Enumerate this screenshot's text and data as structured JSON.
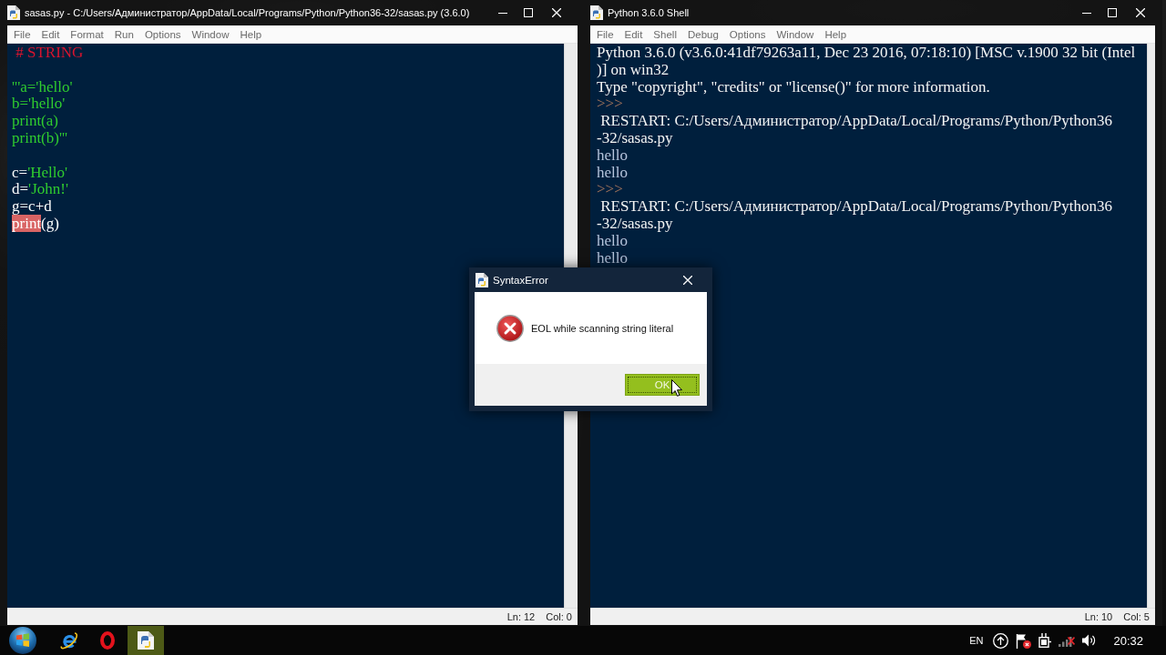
{
  "editor_window": {
    "title": "sasas.py - C:/Users/Администратор/AppData/Local/Programs/Python/Python36-32/sasas.py (3.6.0)",
    "menu": [
      "File",
      "Edit",
      "Format",
      "Run",
      "Options",
      "Window",
      "Help"
    ],
    "blocks": [
      {
        "lines": [
          {
            "segments": [
              {
                "kind": "comment",
                "text": " # STRING"
              }
            ]
          }
        ]
      },
      {
        "lines": [
          {
            "segments": [
              {
                "kind": "string",
                "text": "'''a='hello'"
              }
            ]
          },
          {
            "segments": [
              {
                "kind": "string",
                "text": "b='hello'"
              }
            ]
          },
          {
            "segments": [
              {
                "kind": "string",
                "text": "print(a)"
              }
            ]
          },
          {
            "segments": [
              {
                "kind": "string",
                "text": "print(b)'''"
              }
            ]
          }
        ]
      },
      {
        "lines": [
          {
            "segments": [
              {
                "kind": "plain",
                "text": "c="
              },
              {
                "kind": "string",
                "text": "'Hello'"
              }
            ]
          },
          {
            "segments": [
              {
                "kind": "plain",
                "text": "d="
              },
              {
                "kind": "string",
                "text": "'John!'"
              }
            ]
          },
          {
            "segments": [
              {
                "kind": "plain",
                "text": "g=c+d"
              }
            ]
          },
          {
            "segments": [
              {
                "kind": "error",
                "text": "print"
              },
              {
                "kind": "plain",
                "text": "(g)"
              }
            ]
          }
        ]
      }
    ],
    "status": {
      "line": "Ln: 12",
      "column": "Col: 0"
    }
  },
  "shell_window": {
    "title": "Python 3.6.0 Shell",
    "menu": [
      "File",
      "Edit",
      "Shell",
      "Debug",
      "Options",
      "Window",
      "Help"
    ],
    "lines": [
      {
        "kind": "banner",
        "text": "Python 3.6.0 (v3.6.0:41df79263a11, Dec 23 2016, 07:18:10) [MSC v.1900 32 bit (Intel"
      },
      {
        "kind": "banner",
        "text": ")] on win32"
      },
      {
        "kind": "banner",
        "text": "Type \"copyright\", \"credits\" or \"license()\" for more information."
      },
      {
        "kind": "prompt",
        "text": ">>>"
      },
      {
        "kind": "restart",
        "text": " RESTART: C:/Users/Администратор/AppData/Local/Programs/Python/Python36"
      },
      {
        "kind": "restart",
        "text": "-32/sasas.py"
      },
      {
        "kind": "output",
        "text": "hello"
      },
      {
        "kind": "output",
        "text": "hello"
      },
      {
        "kind": "prompt",
        "text": ">>>"
      },
      {
        "kind": "restart",
        "text": " RESTART: C:/Users/Администратор/AppData/Local/Programs/Python/Python36"
      },
      {
        "kind": "restart",
        "text": "-32/sasas.py"
      },
      {
        "kind": "output",
        "text": "hello"
      },
      {
        "kind": "output",
        "text": "hello"
      }
    ],
    "status": {
      "line": "Ln: 10",
      "column": "Col: 5"
    }
  },
  "dialog": {
    "title": "SyntaxError",
    "message": "EOL while scanning string literal",
    "button": "OK"
  },
  "taskbar": {
    "apps": [
      {
        "kind": "ie",
        "selected": false
      },
      {
        "kind": "opera",
        "selected": false
      },
      {
        "kind": "idle",
        "selected": true
      }
    ],
    "language": "EN",
    "flag_alert": true,
    "network_connected": false,
    "clock": "20:32"
  }
}
